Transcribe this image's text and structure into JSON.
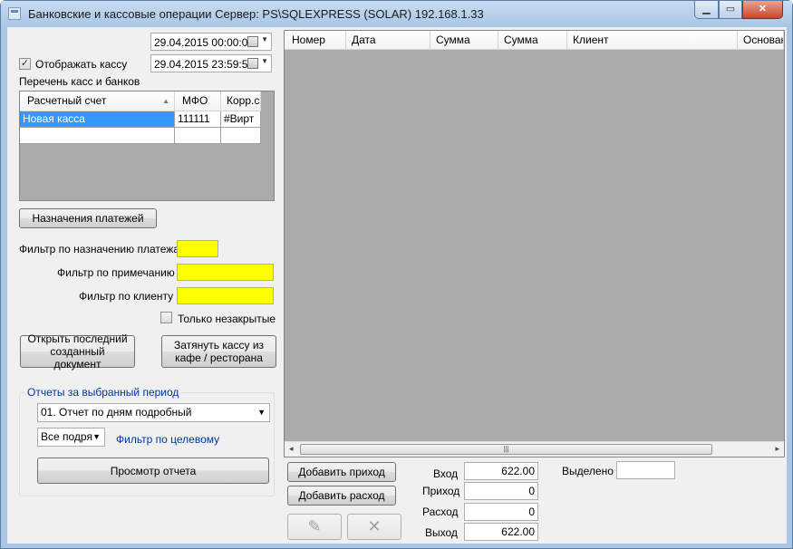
{
  "window": {
    "title": "Банковские и кассовые операции  Сервер: PS\\SQLEXPRESS (SOLAR) 192.168.1.33"
  },
  "date_from": "29.04.2015 00:00:00",
  "date_to": "29.04.2015 23:59:59",
  "show_kassa_label": "Отображать кассу",
  "show_kassa_checked": true,
  "accounts_label": "Перечень касс и банков",
  "accounts_grid": {
    "columns": [
      "Расчетный счет",
      "МФО",
      "Корр.сч"
    ],
    "rows": [
      [
        "Новая касса",
        "111111",
        "#Вирт"
      ],
      [
        "",
        "",
        ""
      ]
    ]
  },
  "payments_purpose_button": "Назначения платежей",
  "filters": {
    "purpose_label": "Фильтр по назначению платежа",
    "note_label": "Фильтр по примечанию",
    "client_label": "Фильтр по клиенту"
  },
  "only_unclosed_label": "Только незакрытые",
  "open_last_button": "Открыть последний созданный документ",
  "pull_kassa_button": "Затянуть кассу из кафе / ресторана",
  "reports": {
    "group_title": "Отчеты за выбранный период",
    "report_type": "01. Отчет по дням подробный",
    "scope": "Все подря",
    "target_filter_link": "Фильтр по целевому",
    "preview_button": "Просмотр отчета"
  },
  "main_grid": {
    "columns": [
      "Номер",
      "Дата",
      "Сумма",
      "Сумма",
      "Клиент",
      "Основани"
    ]
  },
  "add_income_button": "Добавить приход",
  "add_expense_button": "Добавить расход",
  "totals": {
    "vhod_label": "Вход",
    "vhod": "622.00",
    "prihod_label": "Приход",
    "prihod": "0",
    "rashod_label": "Расход",
    "rashod": "0",
    "vyhod_label": "Выход",
    "vyhod": "622.00"
  },
  "selected_label": "Выделено",
  "icons": {
    "edit": "pencil-icon",
    "delete": "cross-icon"
  }
}
